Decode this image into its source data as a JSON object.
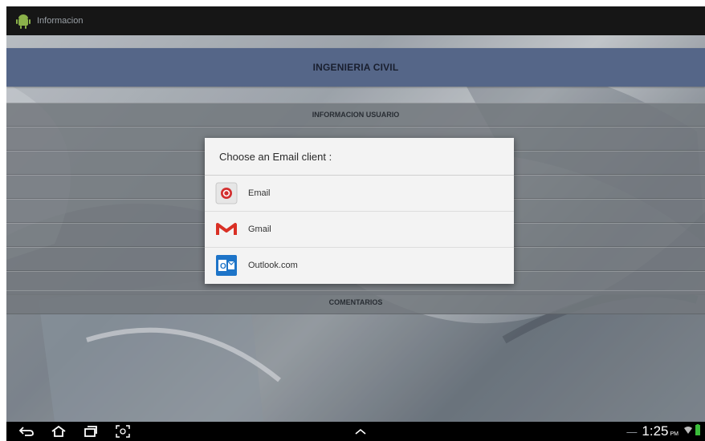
{
  "app": {
    "title": "Informacion",
    "icon": "android-icon"
  },
  "header": {
    "title": "INGENIERIA CIVIL"
  },
  "menu": [
    {
      "label": "INFORMACION USUARIO"
    },
    {
      "label": ""
    },
    {
      "label": ""
    },
    {
      "label": ""
    },
    {
      "label": ""
    },
    {
      "label": ""
    },
    {
      "label": ""
    },
    {
      "label": ""
    },
    {
      "label": "COMENTARIOS"
    }
  ],
  "dialog": {
    "title": "Choose an Email client :",
    "options": [
      {
        "label": "Email",
        "icon": "email-icon"
      },
      {
        "label": "Gmail",
        "icon": "gmail-icon"
      },
      {
        "label": "Outlook.com",
        "icon": "outlook-icon"
      }
    ]
  },
  "statusbar": {
    "time": "1:25",
    "ampm": "PM"
  },
  "colors": {
    "header": "#5d6f94",
    "actionbar": "#161616",
    "dialog": "#f3f3f3"
  }
}
